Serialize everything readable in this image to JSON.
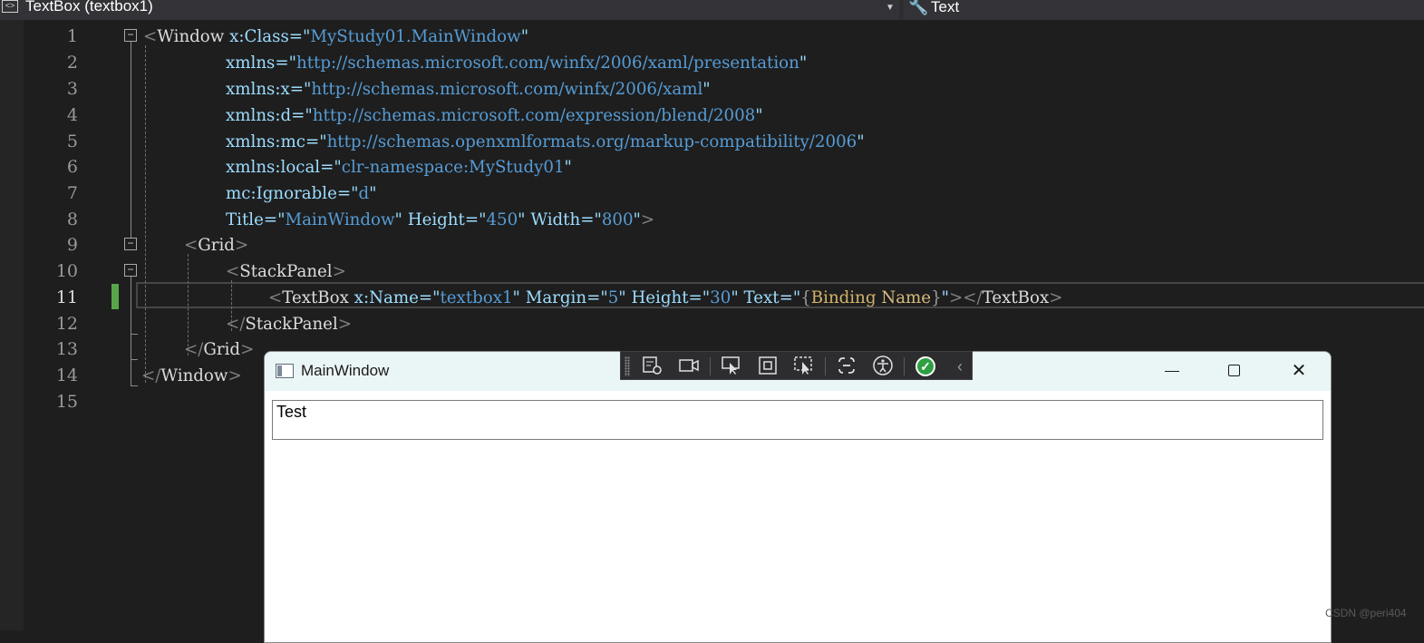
{
  "navbar": {
    "class_icon": "xaml-element-icon",
    "scope": "TextBox (textbox1)",
    "member_icon": "wrench-icon",
    "member": "Text"
  },
  "editor": {
    "line_numbers": [
      "1",
      "2",
      "3",
      "4",
      "5",
      "6",
      "7",
      "8",
      "9",
      "10",
      "11",
      "12",
      "13",
      "14",
      "15"
    ],
    "active_line": "11",
    "lines": {
      "l1": {
        "elem": "Window",
        "attr": "x",
        "attr2": "Class",
        "val": "MyStudy01.MainWindow"
      },
      "l2": {
        "attr": "xmlns",
        "val": "http://schemas.microsoft.com/winfx/2006/xaml/presentation"
      },
      "l3": {
        "attr": "xmlns",
        "attr2": "x",
        "val": "http://schemas.microsoft.com/winfx/2006/xaml"
      },
      "l4": {
        "attr": "xmlns",
        "attr2": "d",
        "val": "http://schemas.microsoft.com/expression/blend/2008"
      },
      "l5": {
        "attr": "xmlns",
        "attr2": "mc",
        "val": "http://schemas.openxmlformats.org/markup-compatibility/2006"
      },
      "l6": {
        "attr": "xmlns",
        "attr2": "local",
        "val": "clr-namespace:MyStudy01"
      },
      "l7": {
        "attr": "mc",
        "attr2": "Ignorable",
        "val": "d"
      },
      "l8": {
        "a1": "Title",
        "v1": "MainWindow",
        "a2": "Height",
        "v2": "450",
        "a3": "Width",
        "v3": "800"
      },
      "l9": {
        "elem": "Grid"
      },
      "l10": {
        "elem": "StackPanel"
      },
      "l11": {
        "elem": "TextBox",
        "a1ns": "x",
        "a1": "Name",
        "v1": "textbox1",
        "a2": "Margin",
        "v2": "5",
        "a3": "Height",
        "v3": "30",
        "a4": "Text",
        "ext": "Binding",
        "param": "Name",
        "close": "TextBox"
      },
      "l12": {
        "elem": "StackPanel"
      },
      "l13": {
        "elem": "Grid"
      },
      "l14": {
        "elem": "Window"
      }
    }
  },
  "app": {
    "title": "MainWindow",
    "textbox_value": "Test",
    "minimize_icon": "minimize-icon",
    "maximize_icon": "maximize-icon",
    "close_glyph": "✕"
  },
  "debug_toolbar": {
    "icons": [
      "go-to-live-visual-tree-icon",
      "show-in-visual-tree-icon",
      "select-element-icon",
      "display-layout-adorners-icon",
      "track-focus-icon",
      "binding-failures-icon",
      "accessibility-checker-icon",
      "hot-reload-icon",
      "collapse-icon"
    ]
  },
  "watermark": "CSDN @peri404"
}
